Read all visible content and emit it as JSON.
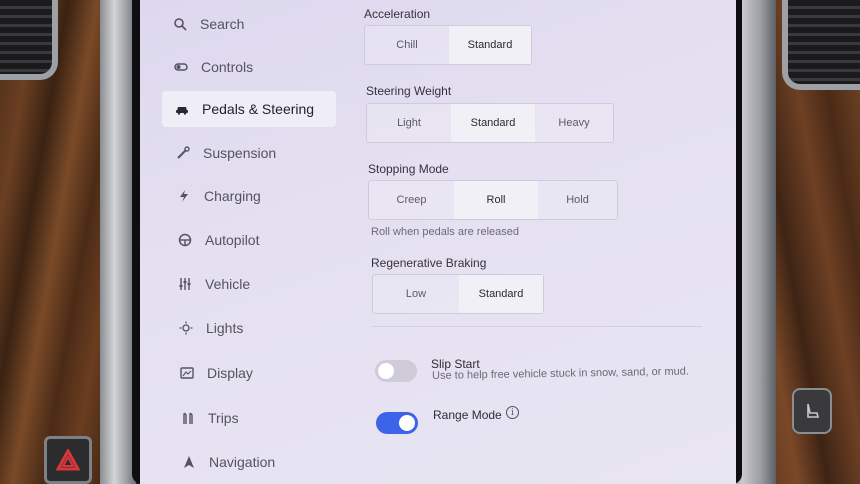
{
  "sidebar": {
    "items": [
      {
        "label": "Search",
        "icon": "search-icon"
      },
      {
        "label": "Controls",
        "icon": "toggle-icon"
      },
      {
        "label": "Pedals & Steering",
        "icon": "car-icon",
        "active": true
      },
      {
        "label": "Suspension",
        "icon": "wrench-icon"
      },
      {
        "label": "Charging",
        "icon": "bolt-icon"
      },
      {
        "label": "Autopilot",
        "icon": "steering-wheel-icon"
      },
      {
        "label": "Vehicle",
        "icon": "sliders-icon"
      },
      {
        "label": "Lights",
        "icon": "sun-icon"
      },
      {
        "label": "Display",
        "icon": "display-icon"
      },
      {
        "label": "Trips",
        "icon": "trips-icon"
      },
      {
        "label": "Navigation",
        "icon": "navigation-arrow-icon"
      }
    ]
  },
  "settings": {
    "acceleration": {
      "label": "Acceleration",
      "options": [
        "Chill",
        "Standard"
      ],
      "selected": "Standard"
    },
    "steering_weight": {
      "label": "Steering Weight",
      "options": [
        "Light",
        "Standard",
        "Heavy"
      ],
      "selected": "Standard"
    },
    "stopping_mode": {
      "label": "Stopping Mode",
      "options": [
        "Creep",
        "Roll",
        "Hold"
      ],
      "selected": "Roll",
      "hint": "Roll when pedals are released"
    },
    "regen_braking": {
      "label": "Regenerative Braking",
      "options": [
        "Low",
        "Standard"
      ],
      "selected": "Standard"
    },
    "slip_start": {
      "title": "Slip Start",
      "description": "Use to help free vehicle stuck in snow, sand, or mud.",
      "enabled": false
    },
    "range_mode": {
      "title": "Range Mode",
      "info_glyph": "i",
      "enabled": true
    }
  },
  "colors": {
    "accent": "#3d63e8",
    "toggle_off": "#cfcbd9"
  }
}
